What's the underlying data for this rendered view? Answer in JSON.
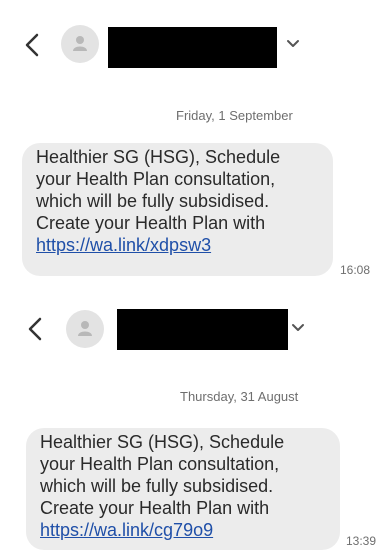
{
  "conversations": [
    {
      "header": {
        "back_icon": "chevron-left-icon",
        "avatar_icon": "person-icon",
        "expand_icon": "chevron-down-icon"
      },
      "date": "Friday, 1 September",
      "message": {
        "lines": [
          "Healthier SG (HSG), Schedule",
          "your Health Plan consultation,",
          "which will be fully subsidised.",
          "Create your Health Plan with"
        ],
        "link": "https://wa.link/xdpsw3",
        "time": "16:08"
      }
    },
    {
      "header": {
        "back_icon": "chevron-left-icon",
        "avatar_icon": "person-icon",
        "expand_icon": "chevron-down-icon"
      },
      "date": "Thursday, 31 August",
      "message": {
        "lines": [
          "Healthier SG (HSG), Schedule",
          "your Health Plan consultation,",
          "which will be fully subsidised.",
          "Create your Health Plan with"
        ],
        "link": "https://wa.link/cg79o9",
        "time": "13:39"
      }
    }
  ],
  "colors": {
    "bubble": "#ececec",
    "link": "#1f4fa8",
    "avatar": "#e3e3e3",
    "redaction": "#000000"
  }
}
